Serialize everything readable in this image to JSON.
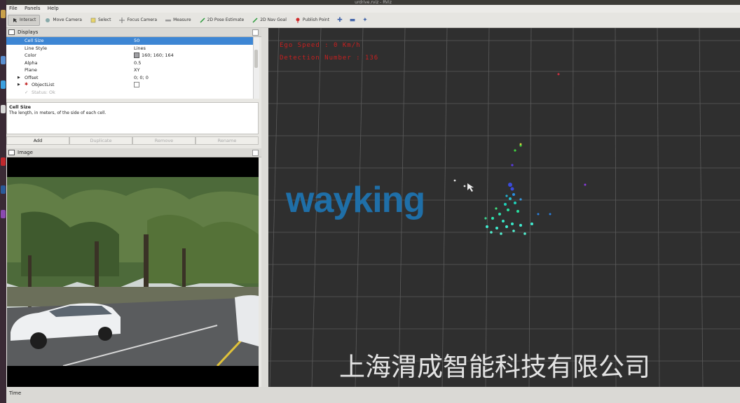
{
  "window": {
    "title": "urdrive.rviz - RViz"
  },
  "menu": [
    "File",
    "Panels",
    "Help"
  ],
  "toolbar": [
    {
      "label": "Interact",
      "icon": "interact-icon",
      "active": true
    },
    {
      "label": "Move Camera",
      "icon": "move-camera-icon"
    },
    {
      "label": "Select",
      "icon": "select-icon"
    },
    {
      "label": "Focus Camera",
      "icon": "focus-camera-icon"
    },
    {
      "label": "Measure",
      "icon": "measure-icon"
    },
    {
      "label": "2D Pose Estimate",
      "icon": "pose-estimate-icon"
    },
    {
      "label": "2D Nav Goal",
      "icon": "nav-goal-icon"
    },
    {
      "label": "Publish Point",
      "icon": "publish-point-icon"
    }
  ],
  "displays": {
    "title": "Displays",
    "rows": [
      {
        "key": "Cell Size",
        "value": "50",
        "selected": true
      },
      {
        "key": "Line Style",
        "value": "Lines"
      },
      {
        "key": "Color",
        "value": "160; 160; 164",
        "swatch": "#a0a0a4"
      },
      {
        "key": "Alpha",
        "value": "0.5"
      },
      {
        "key": "Plane",
        "value": "XY"
      },
      {
        "key": "Offset",
        "value": "0; 0; 0",
        "expander": true
      },
      {
        "key": "ObjectList",
        "value": "",
        "expander": true,
        "checkbox": true
      },
      {
        "key": "Status: Ok",
        "value": "",
        "dim": true
      }
    ],
    "help_title": "Cell Size",
    "help_text": "The length, in meters, of the side of each cell.",
    "buttons": [
      {
        "label": "Add",
        "enabled": true
      },
      {
        "label": "Duplicate",
        "enabled": false
      },
      {
        "label": "Remove",
        "enabled": false
      },
      {
        "label": "Rename",
        "enabled": false
      }
    ]
  },
  "image_panel": {
    "title": "Image"
  },
  "viewport": {
    "hud_speed": "Ego Speed : 0 Km/h",
    "hud_detection": "Detection Number : 136",
    "watermark": "wayking",
    "company": "上海渭成智能科技有限公司"
  },
  "time_panel": {
    "title": "Time"
  },
  "colors": {
    "selection": "#3d86d4",
    "hud_text": "#c82020",
    "watermark": "#1f6fa8",
    "grid": "#6a6a6a"
  }
}
